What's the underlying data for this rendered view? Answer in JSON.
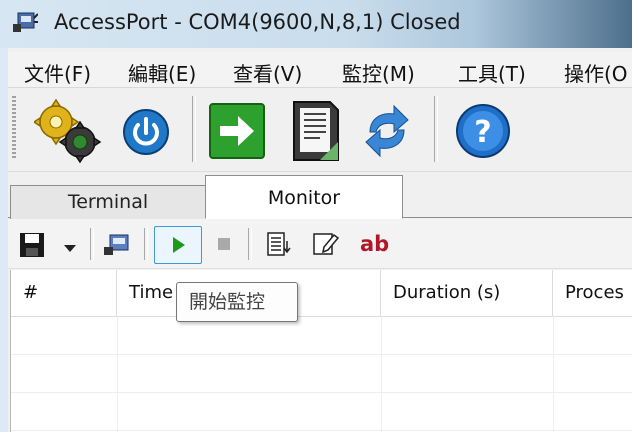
{
  "window": {
    "title": "AccessPort - COM4(9600,N,8,1) Closed"
  },
  "menu": [
    "文件(F)",
    "編輯(E)",
    "查看(V)",
    "監控(M)",
    "工具(T)",
    "操作(O"
  ],
  "toolbar": {
    "buttons": [
      "settings-gears-icon",
      "power-icon",
      "green-arrow-icon",
      "document-icon",
      "sync-arrows-icon",
      "help-icon"
    ]
  },
  "tabs": {
    "terminal": "Terminal",
    "monitor": "Monitor",
    "active": "Monitor"
  },
  "monitor_toolbar": {
    "buttons": [
      "save-icon",
      "save-dropdown-arrow",
      "port-icon",
      "start-monitor-button",
      "stop-monitor-button",
      "filter-list-icon",
      "edit-icon",
      "highlight-text-icon"
    ],
    "highlight_label": "ab"
  },
  "table": {
    "columns": [
      "#",
      "Time",
      "Duration (s)",
      "Proces"
    ],
    "rows": []
  },
  "tooltip": {
    "text": "開始監控"
  },
  "colors": {
    "accent_green": "#2ea02e",
    "ab_red": "#b0182a",
    "help_blue": "#1f6fc9"
  }
}
